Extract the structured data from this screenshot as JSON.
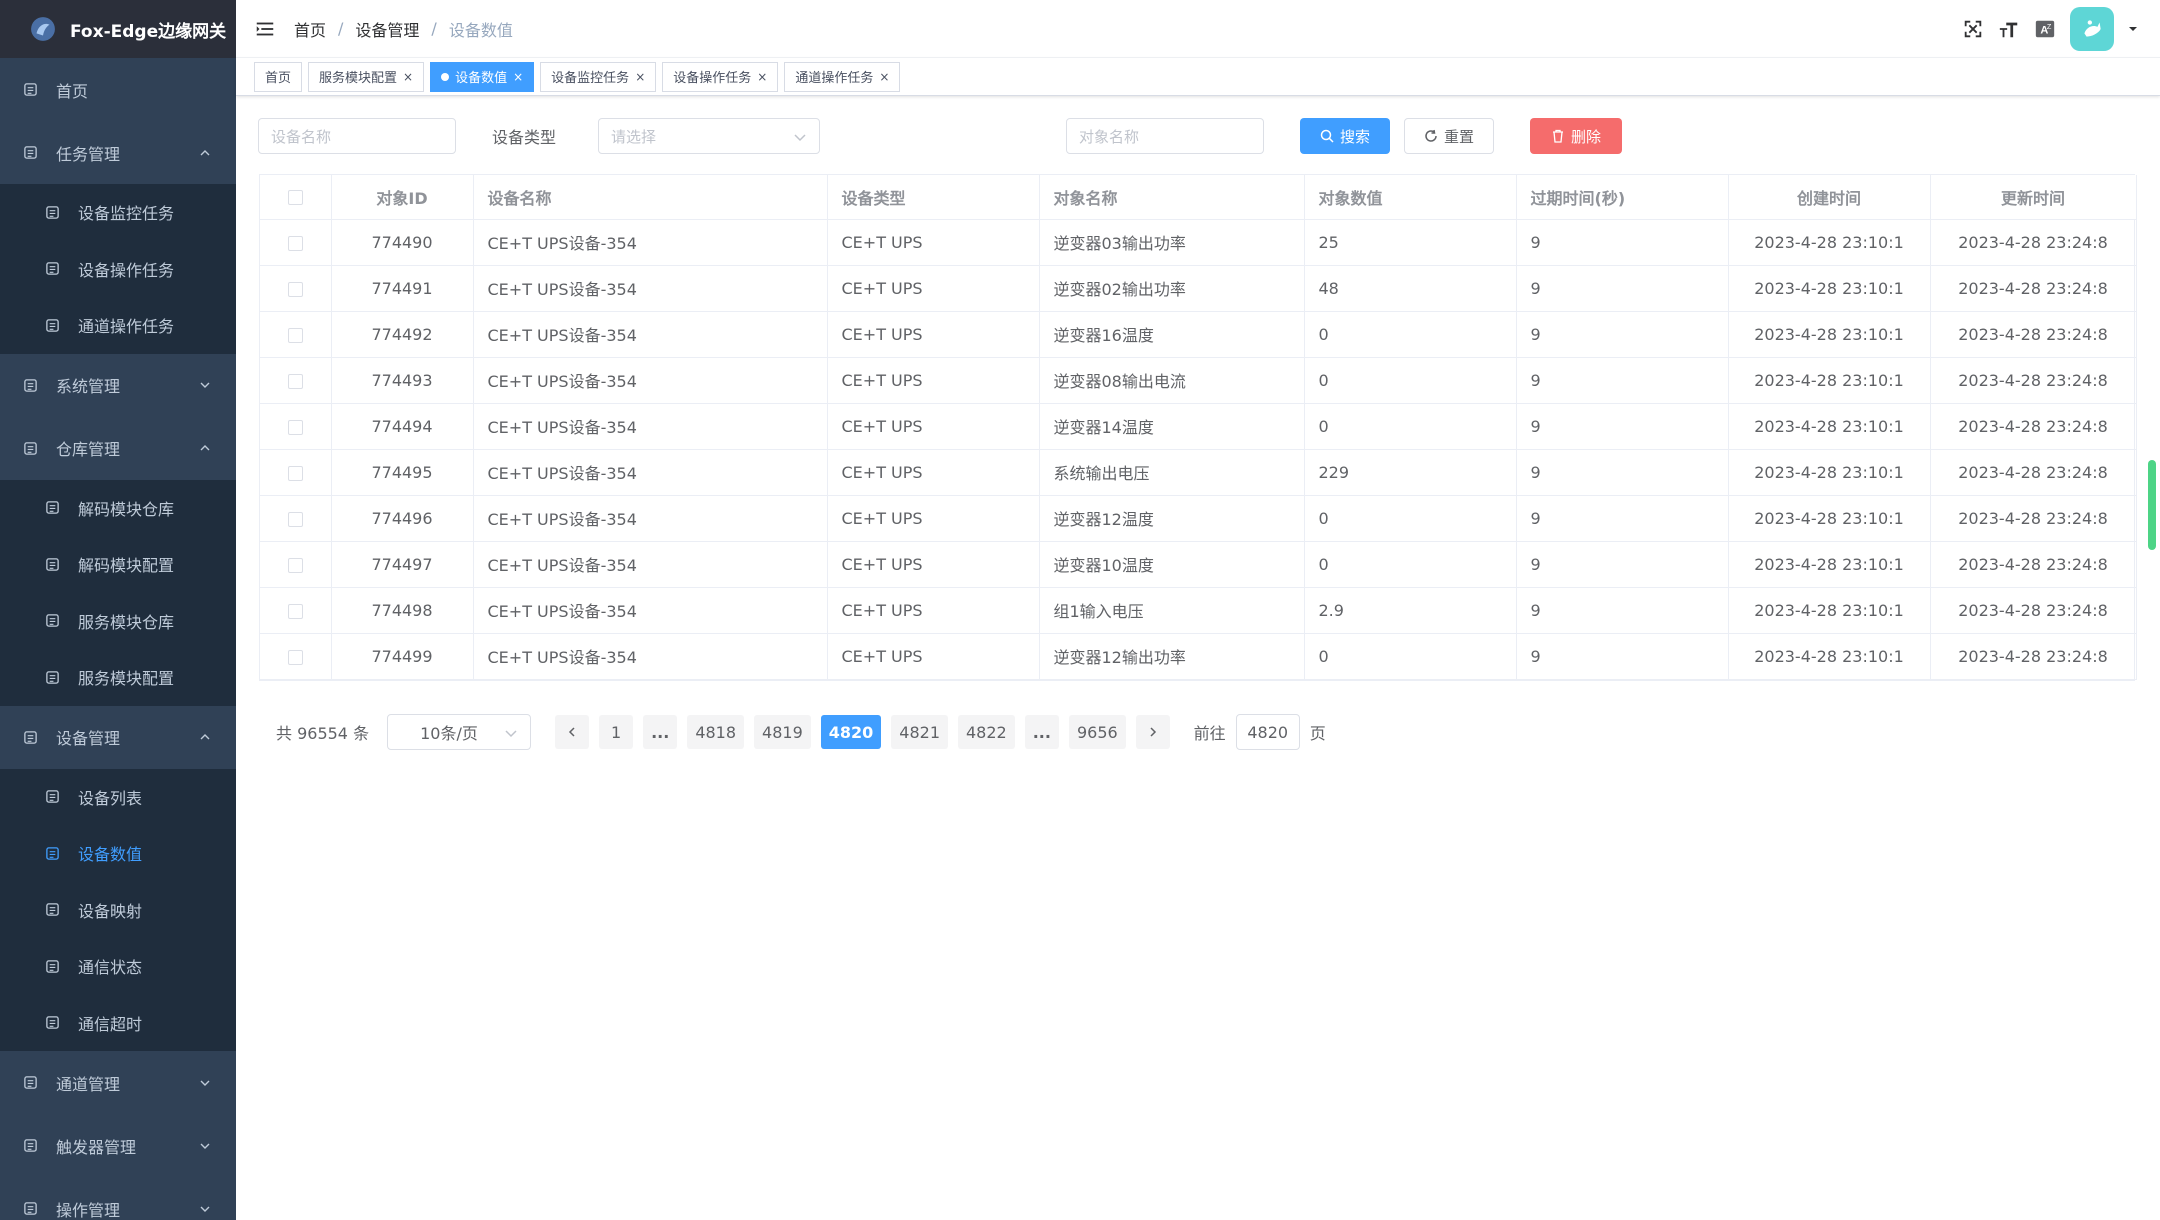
{
  "app": {
    "title": "Fox-Edge边缘网关"
  },
  "sidebar": {
    "items": [
      {
        "label": "首页",
        "icon": "home-icon",
        "type": "item"
      },
      {
        "label": "任务管理",
        "icon": "task-icon",
        "type": "group",
        "expanded": true,
        "children": [
          {
            "label": "设备监控任务",
            "icon": "monitor-task-icon"
          },
          {
            "label": "设备操作任务",
            "icon": "operate-task-icon"
          },
          {
            "label": "通道操作任务",
            "icon": "channel-task-icon"
          }
        ]
      },
      {
        "label": "系统管理",
        "icon": "system-icon",
        "type": "group",
        "expanded": false
      },
      {
        "label": "仓库管理",
        "icon": "warehouse-icon",
        "type": "group",
        "expanded": true,
        "children": [
          {
            "label": "解码模块仓库",
            "icon": "decode-repo-icon"
          },
          {
            "label": "解码模块配置",
            "icon": "decode-config-icon"
          },
          {
            "label": "服务模块仓库",
            "icon": "service-repo-icon"
          },
          {
            "label": "服务模块配置",
            "icon": "service-config-icon"
          }
        ]
      },
      {
        "label": "设备管理",
        "icon": "device-icon",
        "type": "group",
        "expanded": true,
        "children": [
          {
            "label": "设备列表",
            "icon": "device-list-icon"
          },
          {
            "label": "设备数值",
            "icon": "device-value-icon",
            "active": true
          },
          {
            "label": "设备映射",
            "icon": "device-map-icon"
          },
          {
            "label": "通信状态",
            "icon": "comm-status-icon"
          },
          {
            "label": "通信超时",
            "icon": "comm-timeout-icon"
          }
        ]
      },
      {
        "label": "通道管理",
        "icon": "channel-icon",
        "type": "group",
        "expanded": false
      },
      {
        "label": "触发器管理",
        "icon": "trigger-icon",
        "type": "group",
        "expanded": false
      },
      {
        "label": "操作管理",
        "icon": "operation-icon",
        "type": "group",
        "expanded": false
      }
    ]
  },
  "breadcrumb": [
    "首页",
    "设备管理",
    "设备数值"
  ],
  "tags": [
    {
      "label": "首页",
      "closable": false,
      "active": false
    },
    {
      "label": "服务模块配置",
      "closable": true,
      "active": false
    },
    {
      "label": "设备数值",
      "closable": true,
      "active": true
    },
    {
      "label": "设备监控任务",
      "closable": true,
      "active": false
    },
    {
      "label": "设备操作任务",
      "closable": true,
      "active": false
    },
    {
      "label": "通道操作任务",
      "closable": true,
      "active": false
    }
  ],
  "filter": {
    "device_name_placeholder": "设备名称",
    "device_type_label": "设备类型",
    "device_type_placeholder": "请选择",
    "object_name_placeholder": "对象名称",
    "search_label": "搜索",
    "reset_label": "重置",
    "delete_label": "删除"
  },
  "table": {
    "columns": [
      "对象ID",
      "设备名称",
      "设备类型",
      "对象名称",
      "对象数值",
      "过期时间(秒)",
      "创建时间",
      "更新时间"
    ],
    "rows": [
      [
        "774490",
        "CE+T UPS设备-354",
        "CE+T UPS",
        "逆变器03输出功率",
        "25",
        "9",
        "2023-4-28 23:10:1",
        "2023-4-28 23:24:8"
      ],
      [
        "774491",
        "CE+T UPS设备-354",
        "CE+T UPS",
        "逆变器02输出功率",
        "48",
        "9",
        "2023-4-28 23:10:1",
        "2023-4-28 23:24:8"
      ],
      [
        "774492",
        "CE+T UPS设备-354",
        "CE+T UPS",
        "逆变器16温度",
        "0",
        "9",
        "2023-4-28 23:10:1",
        "2023-4-28 23:24:8"
      ],
      [
        "774493",
        "CE+T UPS设备-354",
        "CE+T UPS",
        "逆变器08输出电流",
        "0",
        "9",
        "2023-4-28 23:10:1",
        "2023-4-28 23:24:8"
      ],
      [
        "774494",
        "CE+T UPS设备-354",
        "CE+T UPS",
        "逆变器14温度",
        "0",
        "9",
        "2023-4-28 23:10:1",
        "2023-4-28 23:24:8"
      ],
      [
        "774495",
        "CE+T UPS设备-354",
        "CE+T UPS",
        "系统输出电压",
        "229",
        "9",
        "2023-4-28 23:10:1",
        "2023-4-28 23:24:8"
      ],
      [
        "774496",
        "CE+T UPS设备-354",
        "CE+T UPS",
        "逆变器12温度",
        "0",
        "9",
        "2023-4-28 23:10:1",
        "2023-4-28 23:24:8"
      ],
      [
        "774497",
        "CE+T UPS设备-354",
        "CE+T UPS",
        "逆变器10温度",
        "0",
        "9",
        "2023-4-28 23:10:1",
        "2023-4-28 23:24:8"
      ],
      [
        "774498",
        "CE+T UPS设备-354",
        "CE+T UPS",
        "组1输入电压",
        "2.9",
        "9",
        "2023-4-28 23:10:1",
        "2023-4-28 23:24:8"
      ],
      [
        "774499",
        "CE+T UPS设备-354",
        "CE+T UPS",
        "逆变器12输出功率",
        "0",
        "9",
        "2023-4-28 23:10:1",
        "2023-4-28 23:24:8"
      ]
    ]
  },
  "pagination": {
    "total": "共 96554 条",
    "page_size": "10条/页",
    "pages": [
      "1",
      "...",
      "4818",
      "4819",
      "4820",
      "4821",
      "4822",
      "...",
      "9656"
    ],
    "current": "4820",
    "goto_label": "前往",
    "goto_value": "4820",
    "page_suffix": "页"
  },
  "colors": {
    "sidebar_bg": "#304156",
    "submenu_bg": "#1f2d3d",
    "primary": "#409eff",
    "danger": "#f56c6c",
    "avatar_bg": "#5ed6d6"
  }
}
